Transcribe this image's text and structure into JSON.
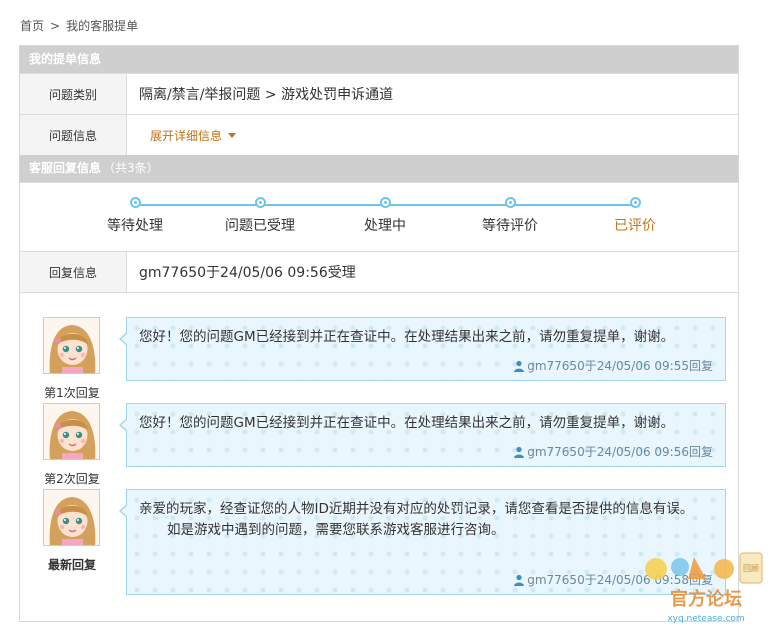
{
  "breadcrumb": {
    "home": "首页",
    "separator": ">",
    "current": "我的客服提单"
  },
  "ticket_section": {
    "title": "我的提单信息"
  },
  "ticket": {
    "type_label": "问题类别",
    "type_value": "隔离/禁言/举报问题 > 游戏处罚申诉通道",
    "info_label": "问题信息",
    "info_link": "展开详细信息"
  },
  "reply_section": {
    "title": "客服回复信息",
    "count": "（共3条）"
  },
  "steps": [
    "等待处理",
    "问题已受理",
    "处理中",
    "等待评价",
    "已评价"
  ],
  "active_step": 4,
  "reply_info": {
    "label": "回复信息",
    "value": "gm77650于24/05/06 09:56受理"
  },
  "replies": [
    {
      "label": "第1次回复",
      "message": "您好！您的问题GM已经接到并正在查证中。在处理结果出来之前，请勿重复提单，谢谢。",
      "message2": "",
      "meta": "gm77650于24/05/06 09:55回复"
    },
    {
      "label": "第2次回复",
      "message": "您好！您的问题GM已经接到并正在查证中。在处理结果出来之前，请勿重复提单，谢谢。",
      "message2": "",
      "meta": "gm77650于24/05/06 09:56回复"
    },
    {
      "label": "最新回复",
      "message": "亲爱的玩家，经查证您的人物ID近期并没有对应的处罚记录，请您查看是否提供的信息有误。",
      "message2": "如是游戏中遇到的问题，需要您联系游戏客服进行咨询。",
      "meta": "gm77650于24/05/06 09:58回复"
    }
  ],
  "watermark": {
    "text": "官方论坛",
    "url": "xyq.netease.com"
  },
  "colors": {
    "accent": "#c0741a",
    "progress": "#6ec4ec",
    "bubble_bg": "#e9f6fd",
    "section_bar": "#cfcfcf"
  },
  "icons": {
    "user": "user-icon",
    "caret": "caret-down-icon"
  }
}
